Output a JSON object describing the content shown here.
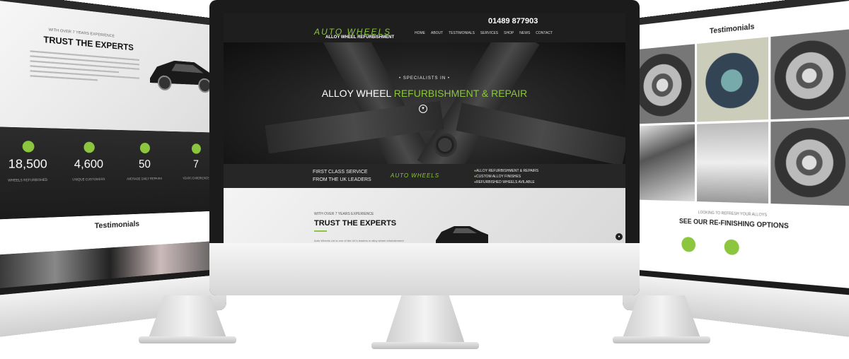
{
  "brand": {
    "accent": "#8cc63f",
    "dark": "#1e1e1e"
  },
  "header": {
    "logo": "AUTO WHEELS",
    "logo_sub": "ALLOY WHEEL REFURBISHMENT",
    "phone": "01489 877903",
    "nav": [
      "HOME",
      "ABOUT",
      "TESTIMONIALS",
      "SERVICES",
      "SHOP",
      "NEWS",
      "CONTACT"
    ]
  },
  "hero": {
    "kicker": "• SPECIALISTS IN •",
    "title_white": "ALLOY WHEEL ",
    "title_green": "REFURBISHMENT & REPAIR",
    "scroll_icon": "chevron-down-icon"
  },
  "band": {
    "left_line1": "FIRST CLASS SERVICE",
    "left_line2": "FROM THE UK LEADERS",
    "logo": "AUTO WHEELS",
    "list": [
      "ALLOY REFURBISHMENT & REPAIRS",
      "CUSTOM ALLOY FINISHES",
      "REFURBISHED WHEELS AVILABLE"
    ]
  },
  "about": {
    "kicker": "WITH OVER 7 YEARS EXPERIENCE",
    "title": "TRUST THE EXPERTS",
    "text": "Auto Wheels Ltd is one of the UK's leaders in alloy wheel refurbishment"
  },
  "left_screen": {
    "kicker": "WITH OVER 7 YEARS EXPERIENCE",
    "title": "TRUST THE EXPERTS",
    "stats": [
      {
        "num": "18,500",
        "label": "WHEELS REFURBISHED"
      },
      {
        "num": "4,600",
        "label": "UNIQUE CUSTOMERS"
      },
      {
        "num": "50",
        "label": "AVERAGE DAILY REPAIRS"
      },
      {
        "num": "7",
        "label": "YEARS EXPERIENCE"
      }
    ],
    "testimonials_title": "Testimonials"
  },
  "right_screen": {
    "testimonials_title": "Testimonials",
    "kicker": "LOOKING TO REFRESH YOUR ALLOYS",
    "options_title": "SEE OUR RE-FINISHING OPTIONS"
  }
}
